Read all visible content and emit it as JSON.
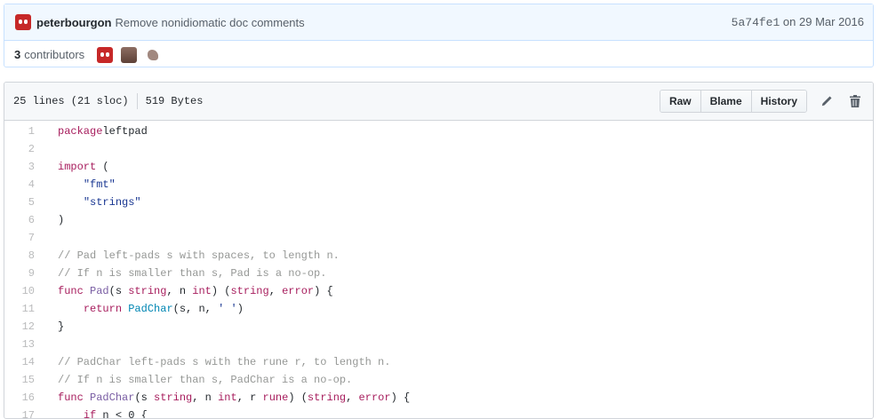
{
  "commit": {
    "author": "peterbourgon",
    "message": "Remove nonidiomatic doc comments",
    "sha": "5a74fe1",
    "date_prefix": "on",
    "date": "29 Mar 2016"
  },
  "contributors": {
    "count": "3",
    "label": "contributors",
    "avatars": [
      "ghost-avatar",
      "bearded-man-avatar",
      "dino-avatar"
    ]
  },
  "file": {
    "lines": "25 lines (21 sloc)",
    "size": "519 Bytes",
    "buttons": {
      "raw": "Raw",
      "blame": "Blame",
      "history": "History"
    },
    "icons": [
      "pencil-icon",
      "trash-icon"
    ]
  },
  "code_lines": [
    {
      "n": "1",
      "t": [
        [
          "kw",
          "package"
        ],
        [
          "",
          "leftpad"
        ]
      ]
    },
    {
      "n": "2",
      "t": []
    },
    {
      "n": "3",
      "t": [
        [
          "kw",
          "import"
        ],
        [
          "",
          " ("
        ]
      ]
    },
    {
      "n": "4",
      "t": [
        [
          "",
          "    "
        ],
        [
          "str",
          "\"fmt\""
        ]
      ]
    },
    {
      "n": "5",
      "t": [
        [
          "",
          "    "
        ],
        [
          "str",
          "\"strings\""
        ]
      ]
    },
    {
      "n": "6",
      "t": [
        [
          "",
          ")"
        ]
      ]
    },
    {
      "n": "7",
      "t": []
    },
    {
      "n": "8",
      "t": [
        [
          "cm",
          "// Pad left-pads s with spaces, to length n."
        ]
      ]
    },
    {
      "n": "9",
      "t": [
        [
          "cm",
          "// If n is smaller than s, Pad is a no-op."
        ]
      ]
    },
    {
      "n": "10",
      "t": [
        [
          "kw",
          "func"
        ],
        [
          "",
          " "
        ],
        [
          "fn",
          "Pad"
        ],
        [
          "",
          "("
        ],
        [
          "",
          "s"
        ],
        [
          "",
          " "
        ],
        [
          "ty",
          "string"
        ],
        [
          "",
          ", "
        ],
        [
          "",
          "n"
        ],
        [
          "",
          " "
        ],
        [
          "ty",
          "int"
        ],
        [
          "",
          ") ("
        ],
        [
          "ty",
          "string"
        ],
        [
          "",
          ", "
        ],
        [
          "ty",
          "error"
        ],
        [
          "",
          ") {"
        ]
      ]
    },
    {
      "n": "11",
      "t": [
        [
          "",
          "    "
        ],
        [
          "kw",
          "return"
        ],
        [
          "",
          " "
        ],
        [
          "call",
          "PadChar"
        ],
        [
          "",
          "(s, n, "
        ],
        [
          "str",
          "' '"
        ],
        [
          "",
          ")"
        ]
      ]
    },
    {
      "n": "12",
      "t": [
        [
          "",
          "}"
        ]
      ]
    },
    {
      "n": "13",
      "t": []
    },
    {
      "n": "14",
      "t": [
        [
          "cm",
          "// PadChar left-pads s with the rune r, to length n."
        ]
      ]
    },
    {
      "n": "15",
      "t": [
        [
          "cm",
          "// If n is smaller than s, PadChar is a no-op."
        ]
      ]
    },
    {
      "n": "16",
      "t": [
        [
          "kw",
          "func"
        ],
        [
          "",
          " "
        ],
        [
          "fn",
          "PadChar"
        ],
        [
          "",
          "("
        ],
        [
          "",
          "s"
        ],
        [
          "",
          " "
        ],
        [
          "ty",
          "string"
        ],
        [
          "",
          ", "
        ],
        [
          "",
          "n"
        ],
        [
          "",
          " "
        ],
        [
          "ty",
          "int"
        ],
        [
          "",
          ", "
        ],
        [
          "",
          "r"
        ],
        [
          "",
          " "
        ],
        [
          "ty",
          "rune"
        ],
        [
          "",
          ") ("
        ],
        [
          "ty",
          "string"
        ],
        [
          "",
          ", "
        ],
        [
          "ty",
          "error"
        ],
        [
          "",
          ") {"
        ]
      ]
    },
    {
      "n": "17",
      "t": [
        [
          "",
          "    "
        ],
        [
          "kw",
          "if"
        ],
        [
          "",
          " n < 0 {"
        ]
      ]
    }
  ]
}
